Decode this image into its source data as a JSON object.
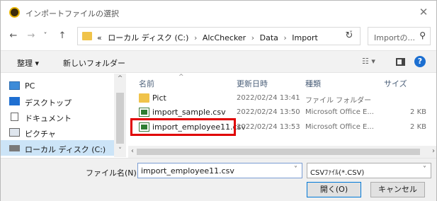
{
  "window": {
    "title": "インポートファイルの選択",
    "close_glyph": "✕"
  },
  "nav": {
    "back_glyph": "←",
    "forward_glyph": "→",
    "recent_glyph": "˅",
    "up_glyph": "↑",
    "breadcrumb": [
      "«",
      "ローカル ディスク (C:)",
      "AlcChecker",
      "Data",
      "Import"
    ],
    "separator": "›",
    "address_dropdown": "˅",
    "refresh_glyph": "↻",
    "search_placeholder": "Importの...",
    "search_glyph": "⚲"
  },
  "toolbar": {
    "organize": "整理 ▾",
    "new_folder": "新しいフォルダー",
    "view_glyph": "☷ ▾",
    "help": "?"
  },
  "sidebar": {
    "items": [
      {
        "label": "PC",
        "icon": "pc-icon"
      },
      {
        "label": "デスクトップ",
        "icon": "desktop-icon"
      },
      {
        "label": "ドキュメント",
        "icon": "documents-icon"
      },
      {
        "label": "ピクチャ",
        "icon": "pictures-icon"
      },
      {
        "label": "ローカル ディスク (C:)",
        "icon": "drive-icon",
        "selected": true
      }
    ],
    "scroll_up": "^",
    "scroll_down": "˅"
  },
  "file_list": {
    "sort_indicator": "^",
    "columns": [
      "名前",
      "更新日時",
      "種類",
      "サイズ"
    ],
    "rows": [
      {
        "name": "Pict",
        "modified": "2022/02/24 13:41",
        "type": "ファイル フォルダー",
        "size": "",
        "icon": "folder-icon"
      },
      {
        "name": "import_sample.csv",
        "modified": "2022/02/24 13:50",
        "type": "Microsoft Office E...",
        "size": "2 KB",
        "icon": "csv-file-icon"
      },
      {
        "name": "import_employee11.csv",
        "modified": "2022/02/24 13:53",
        "type": "Microsoft Office E...",
        "size": "2 KB",
        "icon": "csv-file-icon",
        "highlighted": true
      }
    ],
    "scroll_left": "‹",
    "scroll_right": "›"
  },
  "footer": {
    "filename_label": "ファイル名(N):",
    "filename_value": "import_employee11.csv",
    "filetype_value": "CSVﾌｧｲﾙ(*.CSV)",
    "dropdown_glyph": "˅",
    "open_button": "開く(O)",
    "cancel_button": "キャンセル"
  },
  "colors": {
    "highlight_border": "#e00000",
    "selected_bg": "#cce4f7",
    "folder": "#f0c34a",
    "help_blue": "#1c6fd1"
  }
}
